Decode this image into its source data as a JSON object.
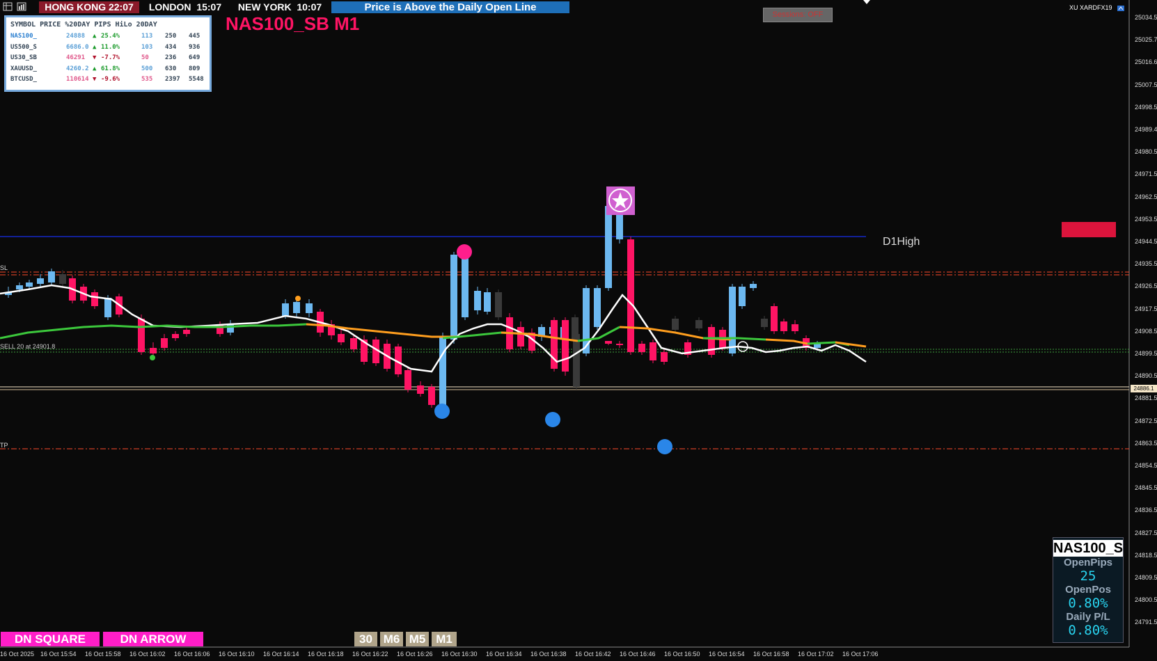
{
  "header": {
    "clocks": [
      {
        "city": "HONG KONG",
        "time": "22:07",
        "bg": "#8b1a2a"
      },
      {
        "city": "LONDON",
        "time": "15:07",
        "bg": "#1e6fb8"
      },
      {
        "city": "NEW YORK",
        "time": "10:07",
        "bg": "#1e6fb8"
      }
    ],
    "status_message": "Price is Above the Daily Open Line",
    "chart_title": "NAS100_SB M1",
    "session_button": "Sessions: OFF",
    "broker_label": "XU XARDFX19"
  },
  "watchlist": {
    "header": "SYMBOL PRICE %20DAY PIPS HiLo 20DAY",
    "rows": [
      {
        "symbol": "NAS100_",
        "price": "24888",
        "arrow": "▲",
        "pct": "25.4%",
        "pips": "113",
        "hilo": "250",
        "d20": "445",
        "dir": "up"
      },
      {
        "symbol": "US500_S",
        "price": "6686.0",
        "arrow": "▲",
        "pct": "11.0%",
        "pips": "103",
        "hilo": "434",
        "d20": "936",
        "dir": "up"
      },
      {
        "symbol": "US30_SB",
        "price": "46291",
        "arrow": "▼",
        "pct": "-7.7%",
        "pips": "50",
        "hilo": "236",
        "d20": "649",
        "dir": "down"
      },
      {
        "symbol": "XAUUSD_",
        "price": "4260.2",
        "arrow": "▲",
        "pct": "61.8%",
        "pips": "500",
        "hilo": "630",
        "d20": "809",
        "dir": "up"
      },
      {
        "symbol": "BTCUSD_",
        "price": "110614",
        "arrow": "▼",
        "pct": "-9.6%",
        "pips": "535",
        "hilo": "2397",
        "d20": "5548",
        "dir": "down"
      }
    ]
  },
  "levels": {
    "d1high_label": "D1High",
    "sl_label": "SL",
    "tp_label": "TP",
    "sell_label": "SELL 20 at 24901.8",
    "current_price": "24886.1"
  },
  "price_scale": [
    "25034.5",
    "25025.7",
    "25016.6",
    "25007.5",
    "24998.5",
    "24989.4",
    "24980.5",
    "24971.5",
    "24962.5",
    "24953.5",
    "24944.5",
    "24935.5",
    "24926.5",
    "24917.5",
    "24908.5",
    "24899.5",
    "24890.5",
    "24881.5",
    "24872.5",
    "24863.5",
    "24854.5",
    "24845.5",
    "24836.5",
    "24827.5",
    "24818.5",
    "24809.5",
    "24800.5",
    "24791.5"
  ],
  "time_axis": [
    "16 Oct 2025",
    "16 Oct 15:54",
    "16 Oct 15:58",
    "16 Oct 16:02",
    "16 Oct 16:06",
    "16 Oct 16:10",
    "16 Oct 16:14",
    "16 Oct 16:18",
    "16 Oct 16:22",
    "16 Oct 16:26",
    "16 Oct 16:30",
    "16 Oct 16:34",
    "16 Oct 16:38",
    "16 Oct 16:42",
    "16 Oct 16:46",
    "16 Oct 16:50",
    "16 Oct 16:54",
    "16 Oct 16:58",
    "16 Oct 17:02",
    "16 Oct 17:06"
  ],
  "bottom_buttons": {
    "dn_square": "DN SQUARE",
    "dn_arrow": "DN ARROW",
    "timeframes": [
      "30",
      "M6",
      "M5",
      "M1"
    ]
  },
  "info_panel": {
    "symbol": "NAS100_S",
    "open_pips_label": "OpenPips",
    "open_pips": "25",
    "open_pos_label": "OpenPos",
    "open_pos": "0.80%",
    "daily_pl_label": "Daily P/L",
    "daily_pl": "0.80%"
  },
  "colors": {
    "bull": "#6cb8f0",
    "bear": "#ff1464",
    "neutral": "#3a3a3a",
    "ma_fast": "#ffffff",
    "ma_green": "#3cc83c",
    "ma_orange": "#ff9e1e",
    "d1high": "#1428c8",
    "title": "#ff1464"
  }
}
